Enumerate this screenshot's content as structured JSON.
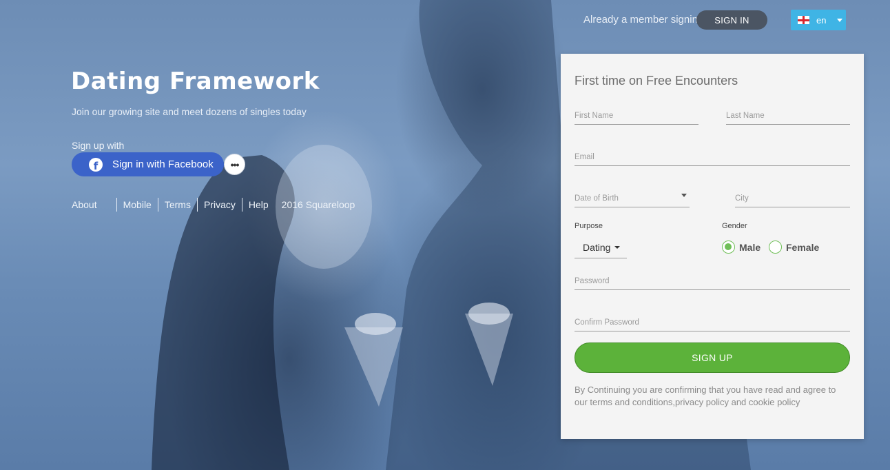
{
  "header": {
    "member_text": "Already a member signin",
    "signin_label": "SIGN IN",
    "language": "en"
  },
  "brand": {
    "title": "Dating Framework",
    "subtitle": "Join our growing site and meet dozens of singles today",
    "signup_with": "Sign up with",
    "facebook_label": "Sign in with Facebook",
    "more_label": "•••"
  },
  "footer": {
    "links": [
      "About",
      "Mobile",
      "Terms",
      "Privacy",
      "Help"
    ],
    "copyright": "2016 Squareloop"
  },
  "form": {
    "title": "First time on Free Encounters",
    "first_name": "First Name",
    "last_name": "Last Name",
    "email": "Email",
    "dob": "Date of Birth",
    "city": "City",
    "purpose_label": "Purpose",
    "purpose_value": "Dating",
    "gender_label": "Gender",
    "gender_options": [
      "Male",
      "Female"
    ],
    "password": "Password",
    "confirm_password": "Confirm Password",
    "signup_label": "SIGN UP",
    "terms": "By Continuing you are confirming that you have read and agree to our terms and conditions,privacy policy and cookie policy"
  },
  "colors": {
    "accent_green": "#5cb23a",
    "facebook_blue": "#3b63c9",
    "lang_blue": "#3fb4e5",
    "signin_gray": "#4b5563"
  }
}
